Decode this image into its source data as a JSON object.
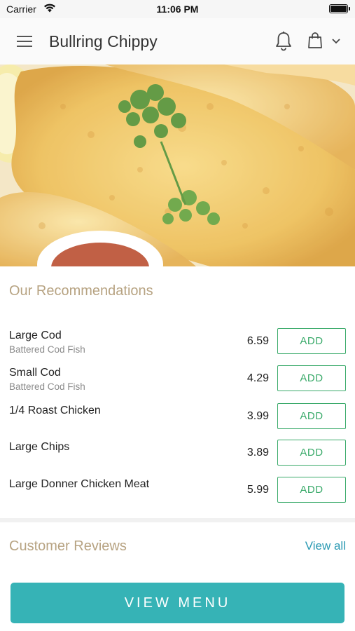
{
  "status_bar": {
    "carrier": "Carrier",
    "time": "11:06 PM"
  },
  "header": {
    "title": "Bullring Chippy",
    "icons": [
      "menu-icon",
      "bell-icon",
      "shopping-bag-icon",
      "chevron-down-icon"
    ]
  },
  "hero": {
    "image": "fried-fish-with-parsley-and-sauce"
  },
  "recommendations": {
    "title": "Our Recommendations",
    "items": [
      {
        "name": "Large Cod",
        "description": "Battered Cod Fish",
        "price": "6.59",
        "button": "ADD"
      },
      {
        "name": "Small Cod",
        "description": "Battered Cod Fish",
        "price": "4.29",
        "button": "ADD"
      },
      {
        "name": "1/4 Roast Chicken",
        "description": "",
        "price": "3.99",
        "button": "ADD"
      },
      {
        "name": "Large Chips",
        "description": "",
        "price": "3.89",
        "button": "ADD"
      },
      {
        "name": "Large Donner Chicken Meat",
        "description": "",
        "price": "5.99",
        "button": "ADD"
      }
    ]
  },
  "reviews": {
    "title": "Customer Reviews",
    "view_all": "View all"
  },
  "footer": {
    "view_menu": "VIEW MENU"
  },
  "colors": {
    "accent": "#36b3b6",
    "add_green": "#3aaa6a",
    "section_title": "#b7a382",
    "link": "#2b9ab3"
  }
}
